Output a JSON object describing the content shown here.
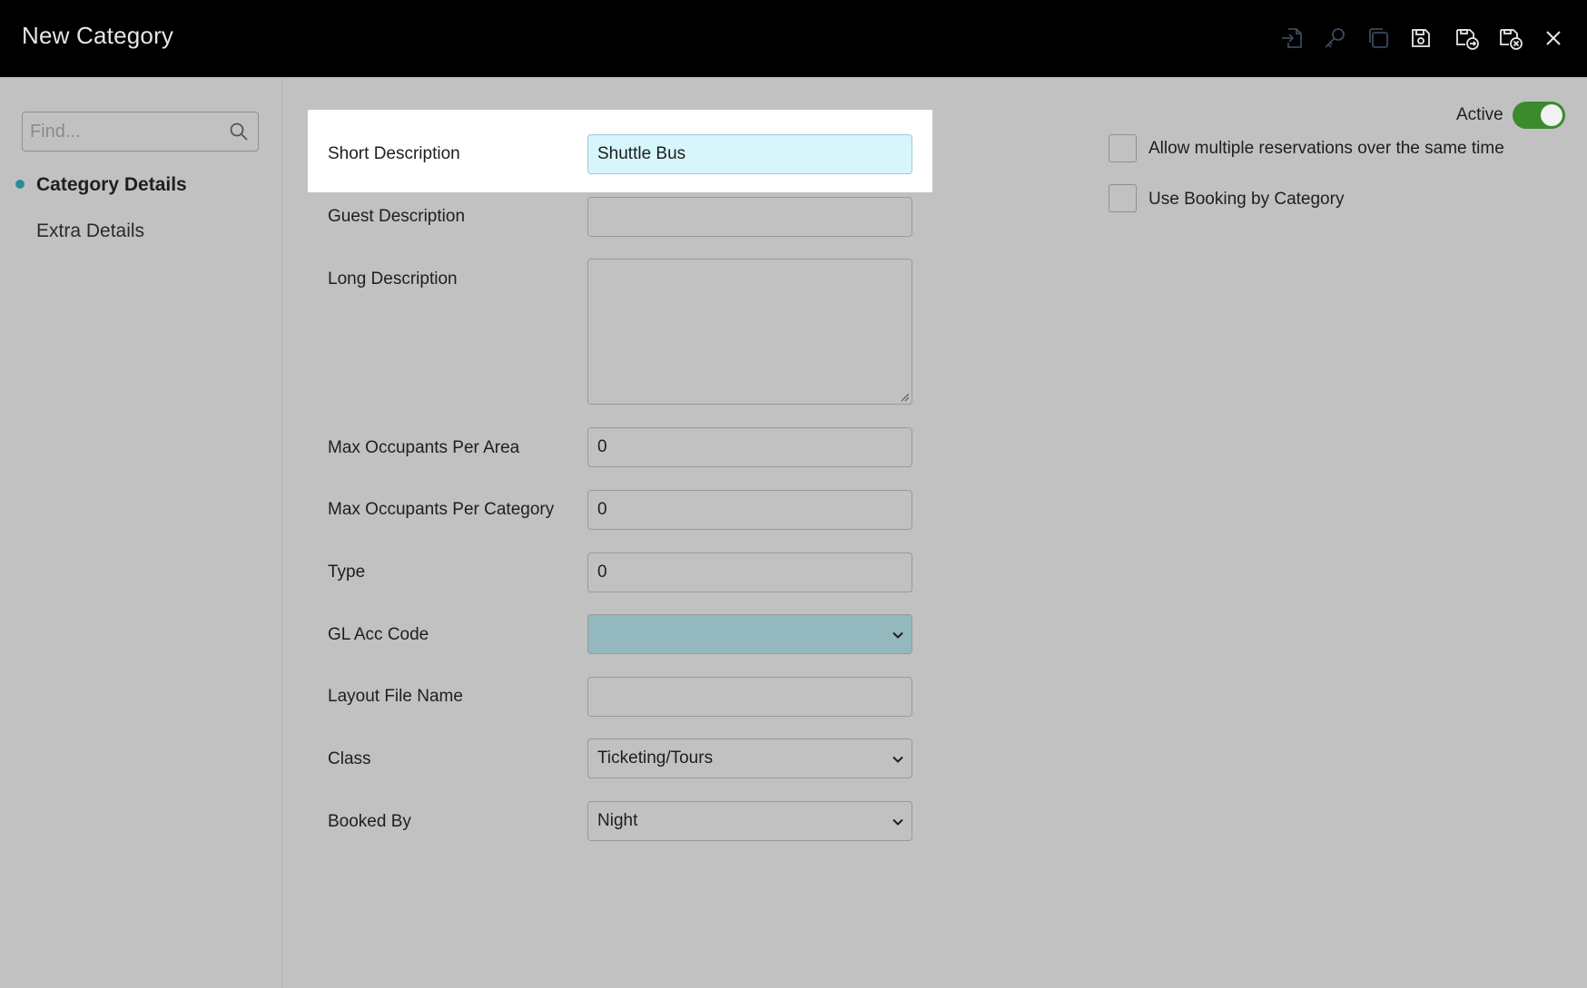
{
  "window": {
    "title": "New Category",
    "toolbar_icons": [
      "import-icon",
      "key-icon",
      "copy-icon",
      "save-icon",
      "save-and-next-icon",
      "save-and-close-icon",
      "close-icon"
    ]
  },
  "sidebar": {
    "search_placeholder": "Find...",
    "items": [
      {
        "label": "Category Details",
        "active": true
      },
      {
        "label": "Extra Details",
        "active": false
      }
    ]
  },
  "form": {
    "short_description": {
      "label": "Short Description",
      "value": "Shuttle Bus"
    },
    "guest_description": {
      "label": "Guest Description",
      "value": ""
    },
    "long_description": {
      "label": "Long Description",
      "value": ""
    },
    "max_occupants_per_area": {
      "label": "Max Occupants Per Area",
      "value": "0"
    },
    "max_occupants_per_category": {
      "label": "Max Occupants Per Category",
      "value": "0"
    },
    "type": {
      "label": "Type",
      "value": "0"
    },
    "gl_acc_code": {
      "label": "GL Acc Code",
      "value": ""
    },
    "layout_file_name": {
      "label": "Layout File Name",
      "value": ""
    },
    "class": {
      "label": "Class",
      "value": "Ticketing/Tours"
    },
    "booked_by": {
      "label": "Booked By",
      "value": "Night"
    }
  },
  "options": {
    "active": {
      "label": "Active",
      "on": true
    },
    "allow_multiple": {
      "label": "Allow multiple reservations over the same time",
      "checked": false
    },
    "booking_by_category": {
      "label": "Use Booking by Category",
      "checked": false
    }
  },
  "colors": {
    "accent": "#2c8b9a",
    "toggle_on": "#3c8a2e",
    "focused_field": "#d6f6fb",
    "gl_select": "#93b8bd"
  }
}
